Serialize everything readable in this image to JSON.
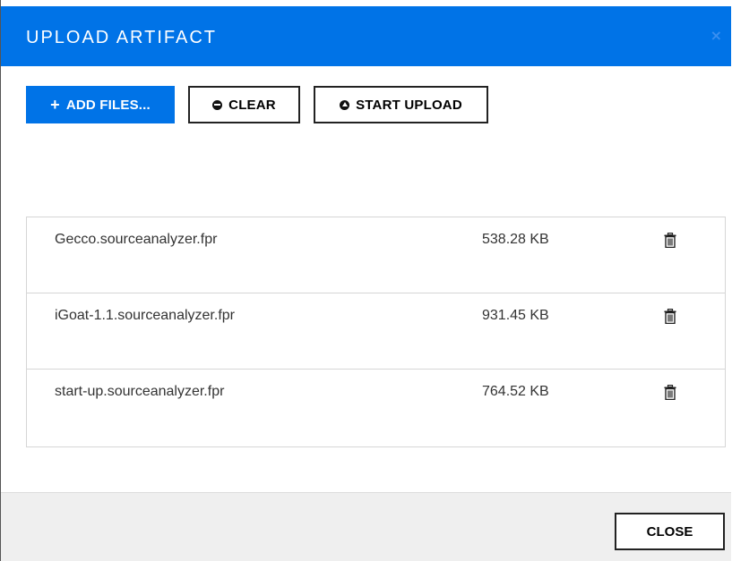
{
  "dialog": {
    "title": "UPLOAD ARTIFACT",
    "close_glyph": "×"
  },
  "toolbar": {
    "add_files_label": "ADD FILES...",
    "clear_label": "CLEAR",
    "start_upload_label": "START UPLOAD",
    "add_icon": "plus-icon",
    "clear_icon": "minus-circle-icon",
    "upload_icon": "arrow-up-circle-icon"
  },
  "files": [
    {
      "name": "Gecco.sourceanalyzer.fpr",
      "size": "538.28 KB"
    },
    {
      "name": "iGoat-1.1.sourceanalyzer.fpr",
      "size": "931.45 KB"
    },
    {
      "name": "start-up.sourceanalyzer.fpr",
      "size": "764.52 KB"
    }
  ],
  "footer": {
    "close_label": "CLOSE"
  },
  "colors": {
    "accent": "#0073e7",
    "footer_bg": "#efefef",
    "row_border": "#d6d6d6"
  }
}
